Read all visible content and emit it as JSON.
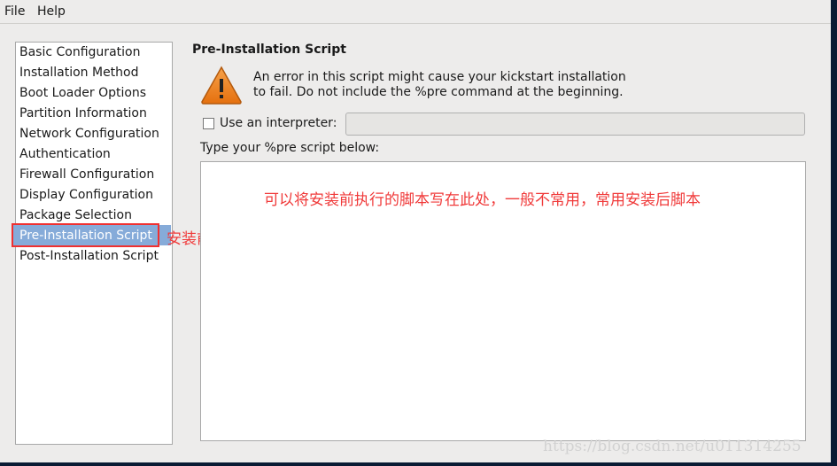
{
  "menu": {
    "file": "File",
    "help": "Help"
  },
  "sidebar": {
    "items": [
      {
        "label": "Basic Configuration"
      },
      {
        "label": "Installation Method"
      },
      {
        "label": "Boot Loader Options"
      },
      {
        "label": "Partition Information"
      },
      {
        "label": "Network Configuration"
      },
      {
        "label": "Authentication"
      },
      {
        "label": "Firewall Configuration"
      },
      {
        "label": "Display Configuration"
      },
      {
        "label": "Package Selection"
      },
      {
        "label": "Pre-Installation Script",
        "selected": true
      },
      {
        "label": "Post-Installation Script"
      }
    ]
  },
  "main": {
    "title": "Pre-Installation Script",
    "warning_line1": "An error in this script might cause your kickstart installation",
    "warning_line2": "to fail. Do not include the %pre command at the beginning.",
    "interpreter_label": "Use an interpreter:",
    "interpreter_value": "",
    "interpreter_checked": false,
    "script_label": "Type your %pre script below:",
    "script_value": ""
  },
  "annotations": {
    "sidebar_note": "安装前脚本",
    "script_note": "可以将安装前执行的脚本写在此处，一般不常用，常用安装后脚本"
  },
  "watermark": "https://blog.csdn.net/u011314255",
  "colors": {
    "selection": "#86abd9",
    "annotation": "#f03a3a",
    "warning": "#f08a1c"
  }
}
